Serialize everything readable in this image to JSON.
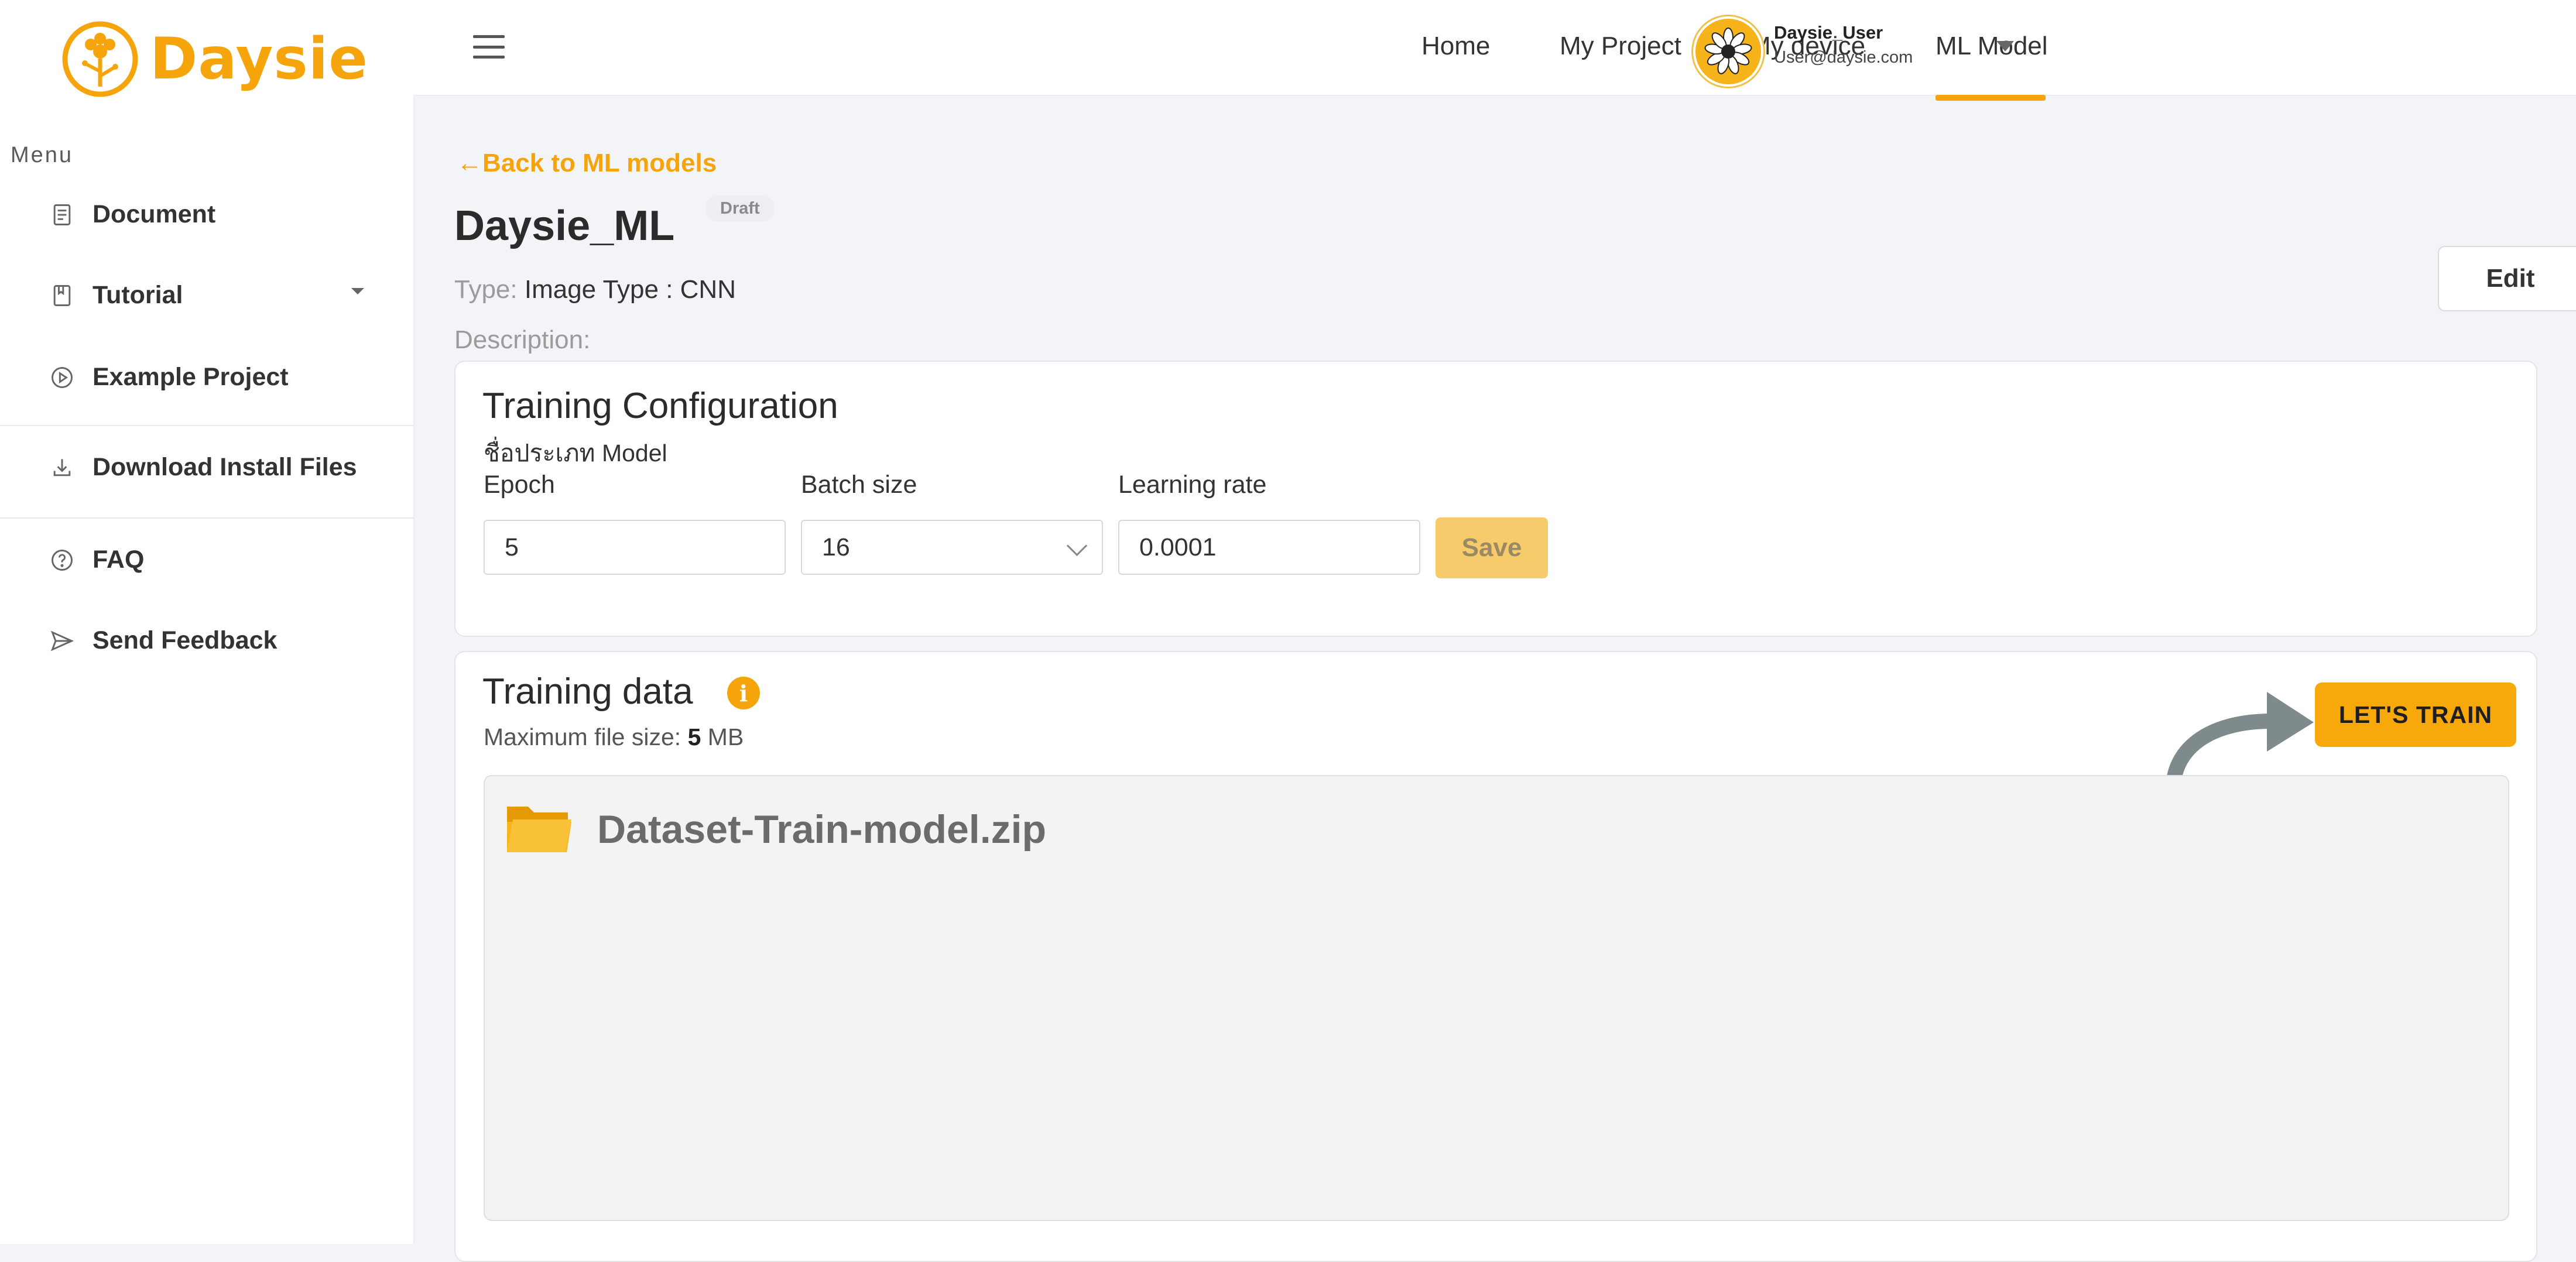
{
  "brand": {
    "name": "Daysie",
    "color": "#f5a50b"
  },
  "sidebar": {
    "heading": "Menu",
    "items": [
      {
        "label": "Document",
        "icon": "document-icon"
      },
      {
        "label": "Tutorial",
        "icon": "book-icon"
      },
      {
        "label": "Example Project",
        "icon": "play-circle-icon"
      },
      {
        "label": "Download Install Files",
        "icon": "download-icon"
      },
      {
        "label": "FAQ",
        "icon": "help-circle-icon"
      },
      {
        "label": "Send Feedback",
        "icon": "send-icon"
      }
    ]
  },
  "topnav": {
    "items": [
      {
        "label": "Home"
      },
      {
        "label": "My Project"
      },
      {
        "label": "My device"
      },
      {
        "label": "ML Model",
        "active": true
      }
    ],
    "user": {
      "name": "Daysie_User",
      "email": "User@daysie.com"
    }
  },
  "page": {
    "back_label": "Back to ML models",
    "title": "Daysie_ML",
    "status_badge": "Draft",
    "type_label": "Type:",
    "type_value": "Image Type : CNN",
    "description_label": "Description:",
    "edit_label": "Edit"
  },
  "training_config": {
    "title": "Training Configuration",
    "subtitle": "ชื่อประเภท Model",
    "epoch": {
      "label": "Epoch",
      "value": "5"
    },
    "batch_size": {
      "label": "Batch size",
      "value": "16"
    },
    "learning_rate": {
      "label": "Learning rate",
      "value": "0.0001"
    },
    "save_label": "Save"
  },
  "training_data": {
    "title": "Training data",
    "max_size_prefix": "Maximum file size:",
    "max_size_value": "5",
    "max_size_unit": "MB",
    "train_button": "LET'S TRAIN",
    "file_name": "Dataset-Train-model.zip"
  },
  "colors": {
    "accent": "#f5a50b",
    "background": "#f3f4f7",
    "arrow": "#7f8a8c"
  }
}
